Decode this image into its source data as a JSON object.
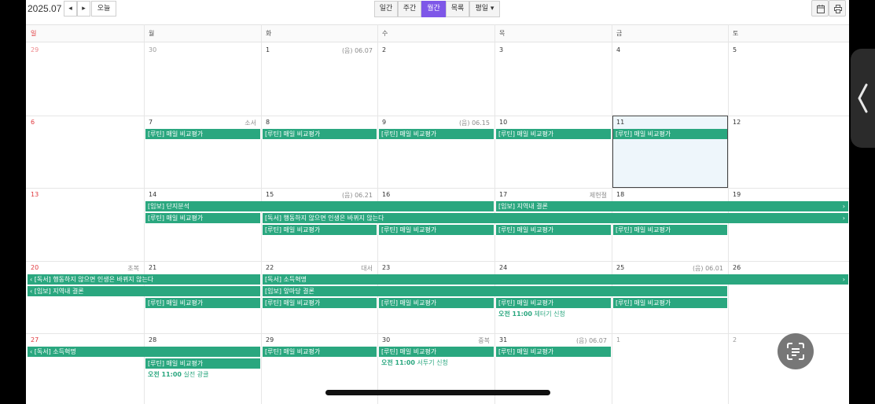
{
  "header": {
    "month": "2025.07",
    "prev_icon": "◂",
    "next_icon": "▸",
    "today_label": "오늘",
    "views": [
      "일간",
      "주간",
      "월간",
      "목록",
      "평일 ▾"
    ],
    "active_view": 2,
    "right_icons": [
      "calendar-icon",
      "print-icon"
    ]
  },
  "weekdays": [
    "일",
    "월",
    "화",
    "수",
    "목",
    "금",
    "토"
  ],
  "weeks": [
    {
      "days": [
        {
          "n": "29",
          "other": true
        },
        {
          "n": "30",
          "other": true
        },
        {
          "n": "1",
          "note": "(음) 06.07"
        },
        {
          "n": "2"
        },
        {
          "n": "3"
        },
        {
          "n": "4"
        },
        {
          "n": "5"
        }
      ]
    },
    {
      "days": [
        {
          "n": "6"
        },
        {
          "n": "7",
          "note": "소서"
        },
        {
          "n": "8"
        },
        {
          "n": "9",
          "note": "(음) 06.15"
        },
        {
          "n": "10"
        },
        {
          "n": "11",
          "today": true
        },
        {
          "n": "12"
        }
      ]
    },
    {
      "days": [
        {
          "n": "13"
        },
        {
          "n": "14"
        },
        {
          "n": "15",
          "note": "(음) 06.21"
        },
        {
          "n": "16"
        },
        {
          "n": "17",
          "note": "제헌절"
        },
        {
          "n": "18"
        },
        {
          "n": "19"
        }
      ]
    },
    {
      "days": [
        {
          "n": "20",
          "note": "초복"
        },
        {
          "n": "21"
        },
        {
          "n": "22",
          "note": "대서"
        },
        {
          "n": "23"
        },
        {
          "n": "24"
        },
        {
          "n": "25",
          "note": "(음) 06.01"
        },
        {
          "n": "26"
        }
      ]
    },
    {
      "days": [
        {
          "n": "27"
        },
        {
          "n": "28"
        },
        {
          "n": "29"
        },
        {
          "n": "30",
          "note": "중복"
        },
        {
          "n": "31",
          "note": "(음) 06.07"
        },
        {
          "n": "1",
          "other": true
        },
        {
          "n": "2",
          "other": true
        }
      ]
    }
  ],
  "events": [
    {
      "week": 1,
      "row": 0,
      "start": 1,
      "span": 1,
      "label": "[루틴] 매일 비교평가"
    },
    {
      "week": 1,
      "row": 0,
      "start": 2,
      "span": 1,
      "label": "[루틴] 매일 비교평가"
    },
    {
      "week": 1,
      "row": 0,
      "start": 3,
      "span": 1,
      "label": "[루틴] 매일 비교평가"
    },
    {
      "week": 1,
      "row": 0,
      "start": 4,
      "span": 1,
      "label": "[루틴] 매일 비교평가"
    },
    {
      "week": 1,
      "row": 0,
      "start": 5,
      "span": 1,
      "label": "[루틴] 매일 비교평가"
    },
    {
      "week": 2,
      "row": 0,
      "start": 1,
      "span": 3,
      "label": "[임보] 단지분석"
    },
    {
      "week": 2,
      "row": 0,
      "start": 4,
      "span": 3,
      "label": "[임보] 지역내 결론",
      "right_arrow": "›"
    },
    {
      "week": 2,
      "row": 1,
      "start": 1,
      "span": 1,
      "label": "[루틴] 매일 비교평가"
    },
    {
      "week": 2,
      "row": 1,
      "start": 2,
      "span": 5,
      "label": "[독서] 행동하지 않으면 인생은 바뀌지 않는다",
      "right_arrow": "›"
    },
    {
      "week": 2,
      "row": 2,
      "start": 2,
      "span": 1,
      "label": "[루틴] 매일 비교평가"
    },
    {
      "week": 2,
      "row": 2,
      "start": 3,
      "span": 1,
      "label": "[루틴] 매일 비교평가"
    },
    {
      "week": 2,
      "row": 2,
      "start": 4,
      "span": 1,
      "label": "[루틴] 매일 비교평가"
    },
    {
      "week": 2,
      "row": 2,
      "start": 5,
      "span": 1,
      "label": "[루틴] 매일 비교평가"
    },
    {
      "week": 3,
      "row": 0,
      "start": 0,
      "span": 2,
      "label": "‹ [독서] 행동하지 않으면 인생은 바뀌지 않는다"
    },
    {
      "week": 3,
      "row": 0,
      "start": 2,
      "span": 5,
      "label": "[독서] 소득혁명",
      "right_arrow": "›"
    },
    {
      "week": 3,
      "row": 1,
      "start": 0,
      "span": 2,
      "label": "‹ [임보] 지역내 결론"
    },
    {
      "week": 3,
      "row": 1,
      "start": 2,
      "span": 4,
      "label": "[임보] 앞마당 결론"
    },
    {
      "week": 3,
      "row": 2,
      "start": 1,
      "span": 1,
      "label": "[루틴] 매일 비교평가"
    },
    {
      "week": 3,
      "row": 2,
      "start": 2,
      "span": 1,
      "label": "[루틴] 매일 비교평가"
    },
    {
      "week": 3,
      "row": 2,
      "start": 3,
      "span": 1,
      "label": "[루틴] 매일 비교평가"
    },
    {
      "week": 3,
      "row": 2,
      "start": 4,
      "span": 1,
      "label": "[루틴] 매일 비교평가"
    },
    {
      "week": 3,
      "row": 2,
      "start": 5,
      "span": 1,
      "label": "[루틴] 매일 비교평가"
    },
    {
      "week": 4,
      "row": 0,
      "start": 0,
      "span": 2,
      "label": "‹ [독서] 소득혁명"
    },
    {
      "week": 4,
      "row": 0,
      "start": 2,
      "span": 1,
      "label": "[루틴] 매일 비교평가"
    },
    {
      "week": 4,
      "row": 0,
      "start": 3,
      "span": 1,
      "label": "[루틴] 매일 비교평가"
    },
    {
      "week": 4,
      "row": 0,
      "start": 4,
      "span": 1,
      "label": "[루틴] 매일 비교평가"
    },
    {
      "week": 4,
      "row": 1,
      "start": 1,
      "span": 1,
      "label": "[루틴] 매일 비교평가"
    }
  ],
  "timed_events": [
    {
      "week": 3,
      "row": 3,
      "col": 4,
      "time": "오전 11:00",
      "title": "체터기 신청"
    },
    {
      "week": 4,
      "row": 1,
      "col": 3,
      "time": "오전 11:00",
      "title": "서투기 신청"
    },
    {
      "week": 4,
      "row": 2,
      "col": 1,
      "time": "오전 11:00",
      "title": "실전 광클"
    }
  ],
  "overlay": {
    "side_tab_icon": "chevron-left-icon",
    "lens_icon": "scan-text-icon"
  }
}
